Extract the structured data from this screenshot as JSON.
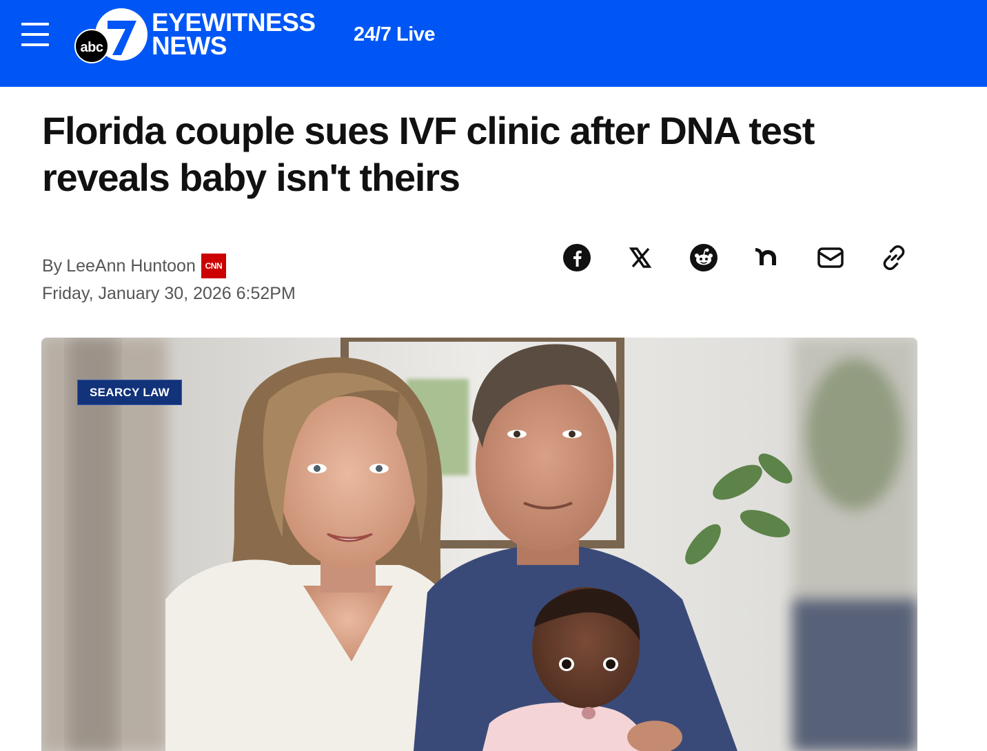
{
  "header": {
    "menu_icon": "hamburger-menu-icon",
    "brand_abc": "abc",
    "brand_line1": "EYEWITNESS",
    "brand_line2": "NEWS",
    "live_label": "24/7 Live",
    "brand_color": "#0056f5"
  },
  "article": {
    "headline": "Florida couple sues IVF clinic after DNA test reveals baby isn't theirs",
    "byline_prefix": "By",
    "author": "LeeAnn Huntoon",
    "source_badge": "CNN",
    "date": "Friday, January 30, 2026 6:52PM"
  },
  "share": {
    "icons": [
      "facebook-icon",
      "x-icon",
      "reddit-icon",
      "nextdoor-icon",
      "email-icon",
      "copy-link-icon"
    ]
  },
  "hero": {
    "watermark": "SEARCY LAW"
  }
}
